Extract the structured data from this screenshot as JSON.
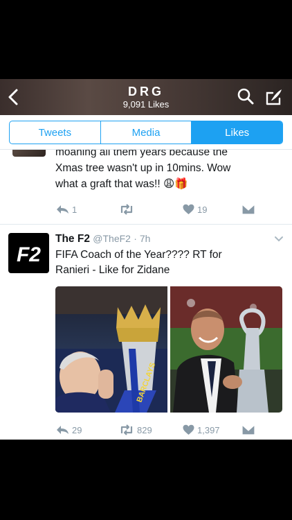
{
  "header": {
    "title": "DRG",
    "subtitle": "9,091 Likes"
  },
  "tabs": [
    {
      "label": "Tweets",
      "active": false
    },
    {
      "label": "Media",
      "active": false
    },
    {
      "label": "Likes",
      "active": true
    }
  ],
  "tweets": [
    {
      "text_lines": [
        "moaning all them years because the",
        "Xmas tree wasn't up in 10mins. Wow",
        "what a graft that was!! 😩🎁"
      ],
      "reply_count": "1",
      "retweet_count": "",
      "like_count": "19"
    },
    {
      "name": "The F2",
      "handle": "@TheF2",
      "time": "· 7h",
      "avatar_text": "F2",
      "text_lines": [
        "FIFA Coach of the Year???? RT for",
        "Ranieri - Like for Zidane"
      ],
      "reply_count": "29",
      "retweet_count": "829",
      "like_count": "1,397"
    }
  ],
  "colors": {
    "accent": "#1da1f2",
    "muted": "#8899a6"
  }
}
